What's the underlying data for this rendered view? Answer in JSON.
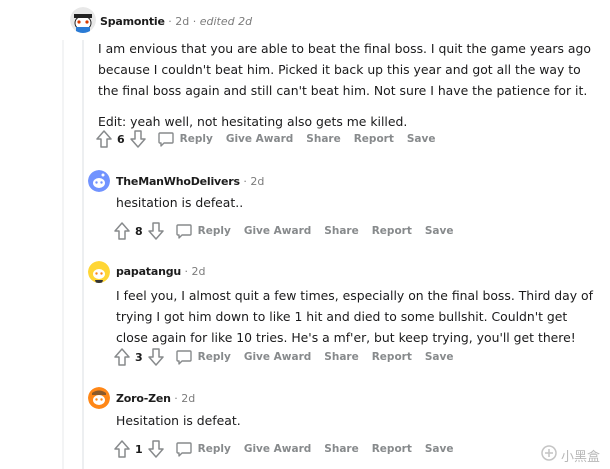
{
  "comments": [
    {
      "username": "Spamontie",
      "time": "2d",
      "edited": "edited 2d",
      "paragraphs": [
        "I am envious that you are able to beat the final boss. I quit the game years ago because I couldn't beat him. Picked it back up this year and got all the way to the final boss again and still can't beat him. Not sure I have the patience for it.",
        "Edit: yeah well, not hesitating also gets me killed."
      ],
      "score": "6"
    },
    {
      "username": "TheManWhoDelivers",
      "time": "2d",
      "paragraphs": [
        "hesitation is defeat.."
      ],
      "score": "8"
    },
    {
      "username": "papatangu",
      "time": "2d",
      "paragraphs": [
        "I feel you, I almost quit a few times, especially on the final boss. Third day of trying I got him down to like 1 hit and died to some bullshit. Couldn't get close again for like 10 tries. He's a mf'er, but keep trying, you'll get there!"
      ],
      "score": "3"
    },
    {
      "username": "Zoro-Zen",
      "time": "2d",
      "paragraphs": [
        "Hesitation is defeat."
      ],
      "score": "1"
    }
  ],
  "actions": {
    "reply": "Reply",
    "give_award": "Give Award",
    "share": "Share",
    "report": "Report",
    "save": "Save"
  },
  "separator": "·",
  "watermark": "小黑盒",
  "colors": {
    "meta_gray": "#7c7c7c",
    "action_gray": "#878a8c",
    "thread_line": "#edeff1",
    "avatar_blue": "#7193ff",
    "avatar_yellow": "#ffd635",
    "avatar_orange": "#ff8717"
  }
}
